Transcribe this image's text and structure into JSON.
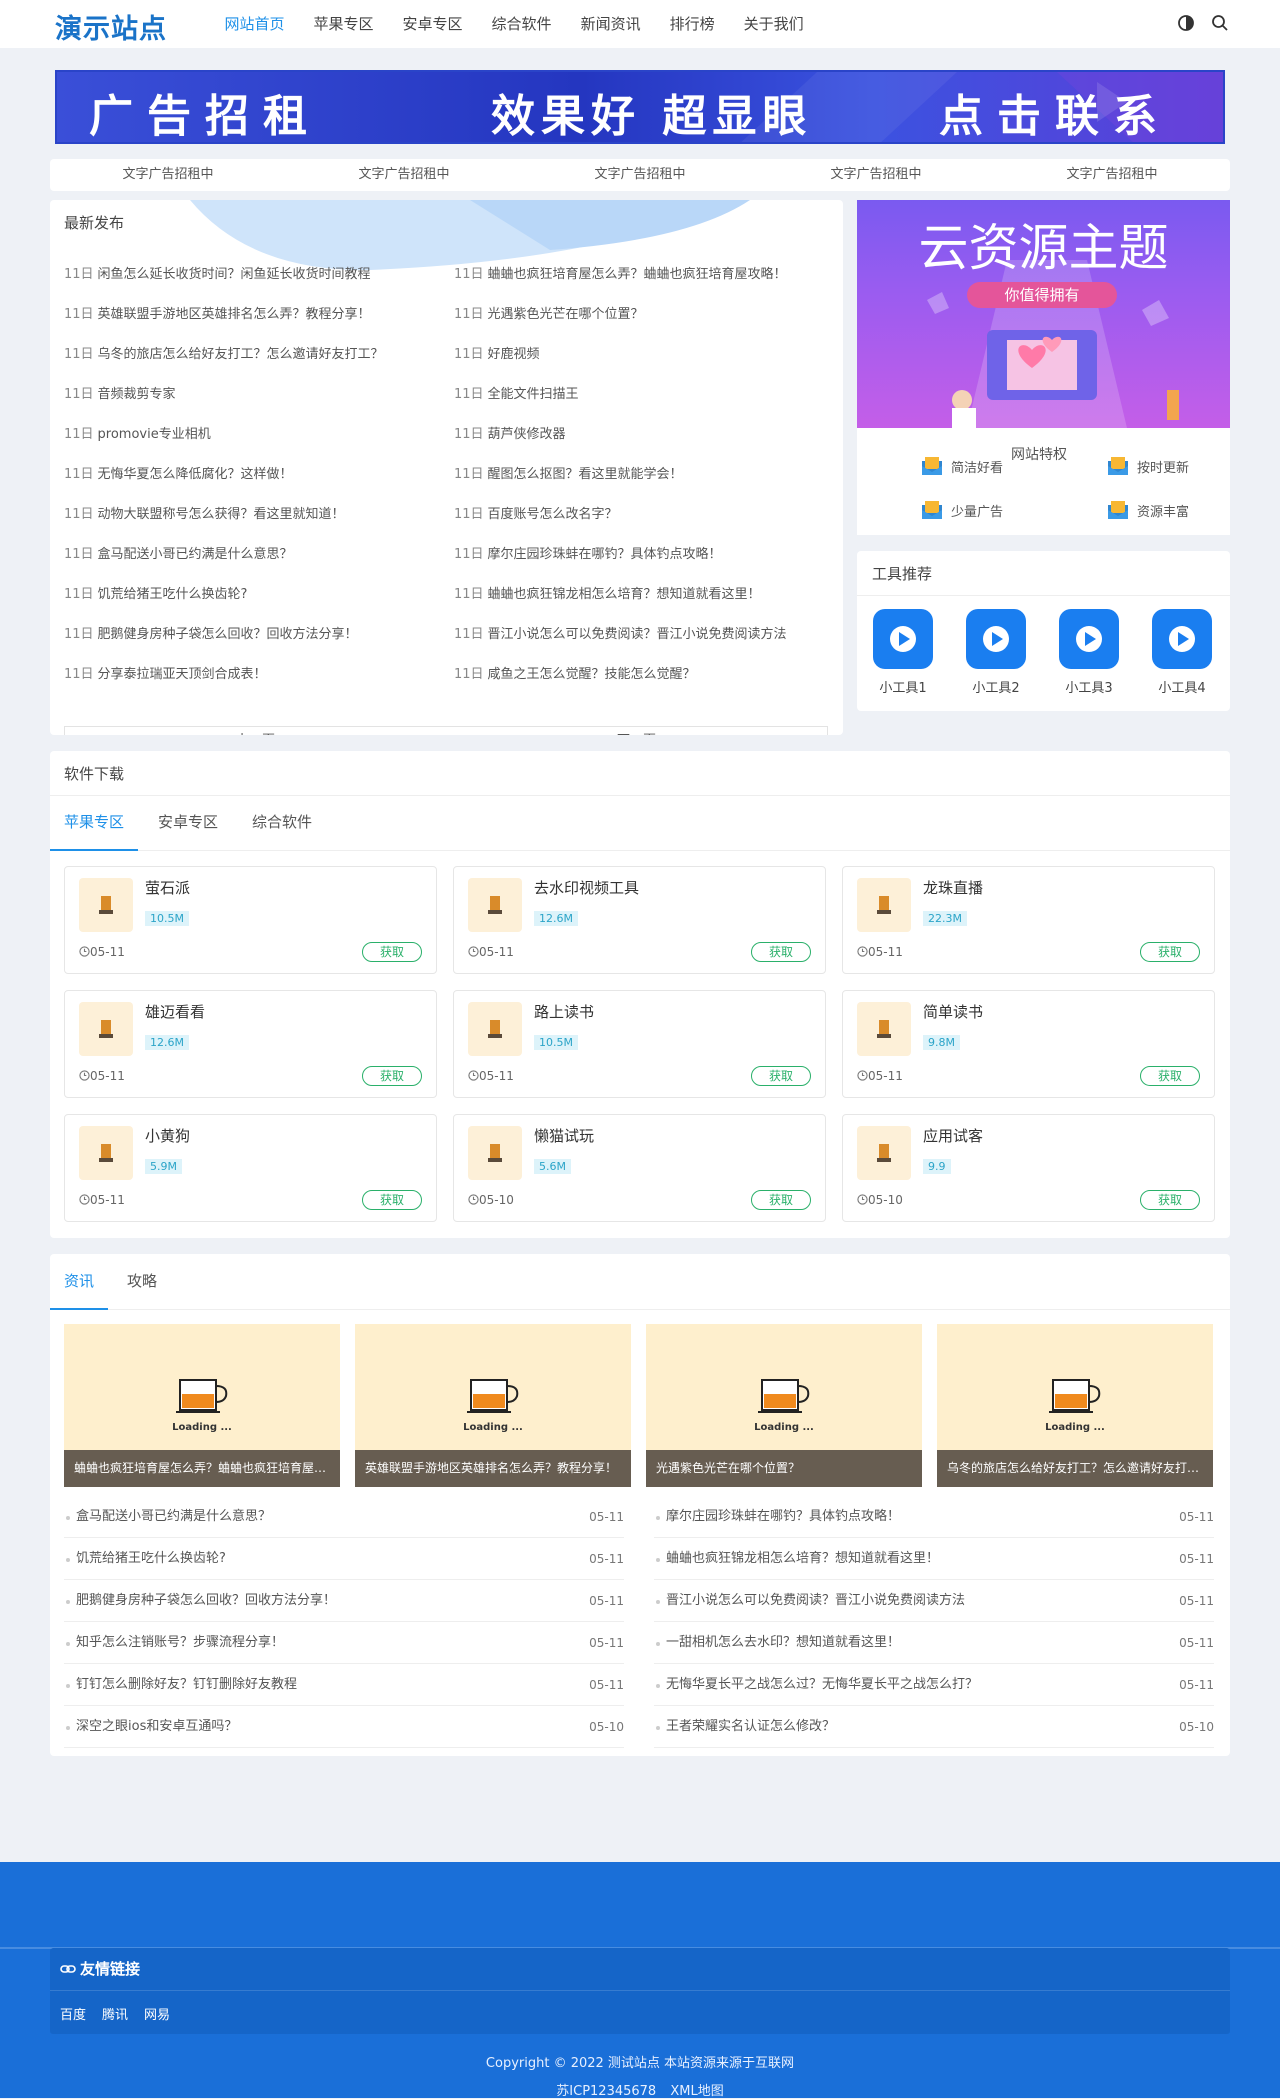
{
  "site": {
    "logo": "演示站点"
  },
  "nav": [
    {
      "label": "网站首页",
      "active": true
    },
    {
      "label": "苹果专区"
    },
    {
      "label": "安卓专区"
    },
    {
      "label": "综合软件"
    },
    {
      "label": "新闻资讯"
    },
    {
      "label": "排行榜"
    },
    {
      "label": "关于我们"
    }
  ],
  "header_icons": [
    "theme-toggle-icon",
    "search-icon"
  ],
  "banner": {
    "left": "广告招租",
    "mid": "效果好 超显眼",
    "right": "点击联系"
  },
  "text_ads": [
    "文字广告招租中",
    "文字广告招租中",
    "文字广告招租中",
    "文字广告招租中",
    "文字广告招租中"
  ],
  "latest": {
    "title": "最新发布",
    "left": [
      {
        "d": "11日",
        "t": "闲鱼怎么延长收货时间？闲鱼延长收货时间教程"
      },
      {
        "d": "11日",
        "t": "英雄联盟手游地区英雄排名怎么弄？教程分享！"
      },
      {
        "d": "11日",
        "t": "乌冬的旅店怎么给好友打工？怎么邀请好友打工？"
      },
      {
        "d": "11日",
        "t": "音频裁剪专家"
      },
      {
        "d": "11日",
        "t": "promovie专业相机"
      },
      {
        "d": "11日",
        "t": "无悔华夏怎么降低腐化？这样做！"
      },
      {
        "d": "11日",
        "t": "动物大联盟称号怎么获得？看这里就知道！"
      },
      {
        "d": "11日",
        "t": "盒马配送小哥已约满是什么意思？"
      },
      {
        "d": "11日",
        "t": "饥荒给猪王吃什么换齿轮?"
      },
      {
        "d": "11日",
        "t": "肥鹅健身房种子袋怎么回收？回收方法分享！"
      },
      {
        "d": "11日",
        "t": "分享泰拉瑞亚天顶剑合成表！"
      }
    ],
    "right": [
      {
        "d": "11日",
        "t": "蛐蛐也疯狂培育屋怎么弄？蛐蛐也疯狂培育屋攻略！"
      },
      {
        "d": "11日",
        "t": "光遇紫色光芒在哪个位置？"
      },
      {
        "d": "11日",
        "t": "好鹿视频"
      },
      {
        "d": "11日",
        "t": "全能文件扫描王"
      },
      {
        "d": "11日",
        "t": "葫芦侠修改器"
      },
      {
        "d": "11日",
        "t": "醒图怎么抠图？看这里就能学会！"
      },
      {
        "d": "11日",
        "t": "百度账号怎么改名字？"
      },
      {
        "d": "11日",
        "t": "摩尔庄园珍珠蚌在哪钓？具体钓点攻略！"
      },
      {
        "d": "11日",
        "t": "蛐蛐也疯狂锦龙相怎么培育？想知道就看这里！"
      },
      {
        "d": "11日",
        "t": "晋江小说怎么可以免费阅读？晋江小说免费阅读方法"
      },
      {
        "d": "11日",
        "t": "咸鱼之王怎么觉醒？技能怎么觉醒？"
      }
    ],
    "prev": "上一页",
    "next": "下一页"
  },
  "promo": {
    "title": "云资源主题",
    "sub": "你值得拥有"
  },
  "features": {
    "title": "网站特权",
    "items": [
      "简洁好看",
      "按时更新",
      "少量广告",
      "资源丰富"
    ]
  },
  "tools": {
    "title": "工具推荐",
    "items": [
      "小工具1",
      "小工具2",
      "小工具3",
      "小工具4"
    ]
  },
  "software": {
    "title": "软件下载",
    "tabs": [
      "苹果专区",
      "安卓专区",
      "综合软件"
    ],
    "get_label": "获取",
    "cards": [
      {
        "name": "萤石派",
        "size": "10.5M",
        "date": "05-11"
      },
      {
        "name": "去水印视频工具",
        "size": "12.6M",
        "date": "05-11"
      },
      {
        "name": "龙珠直播",
        "size": "22.3M",
        "date": "05-11"
      },
      {
        "name": "雄迈看看",
        "size": "12.6M",
        "date": "05-11"
      },
      {
        "name": "路上读书",
        "size": "10.5M",
        "date": "05-11"
      },
      {
        "name": "简单读书",
        "size": "9.8M",
        "date": "05-11"
      },
      {
        "name": "小黄狗",
        "size": "5.9M",
        "date": "05-11"
      },
      {
        "name": "懒猫试玩",
        "size": "5.6M",
        "date": "05-10"
      },
      {
        "name": "应用试客",
        "size": "9.9",
        "date": "05-10"
      }
    ]
  },
  "info": {
    "tabs": [
      "资讯",
      "攻略"
    ],
    "loading": "Loading ...",
    "thumbs": [
      "蛐蛐也疯狂培育屋怎么弄？蛐蛐也疯狂培育屋攻略！",
      "英雄联盟手游地区英雄排名怎么弄？教程分享！",
      "光遇紫色光芒在哪个位置？",
      "乌冬的旅店怎么给好友打工？怎么邀请好友打工？"
    ],
    "left": [
      {
        "t": "盒马配送小哥已约满是什么意思？",
        "d": "05-11"
      },
      {
        "t": "饥荒给猪王吃什么换齿轮?",
        "d": "05-11"
      },
      {
        "t": "肥鹅健身房种子袋怎么回收？回收方法分享！",
        "d": "05-11"
      },
      {
        "t": "知乎怎么注销账号？步骤流程分享！",
        "d": "05-11"
      },
      {
        "t": "钉钉怎么删除好友？钉钉删除好友教程",
        "d": "05-11"
      },
      {
        "t": "深空之眼ios和安卓互通吗？",
        "d": "05-10"
      }
    ],
    "right": [
      {
        "t": "摩尔庄园珍珠蚌在哪钓？具体钓点攻略！",
        "d": "05-11"
      },
      {
        "t": "蛐蛐也疯狂锦龙相怎么培育？想知道就看这里！",
        "d": "05-11"
      },
      {
        "t": "晋江小说怎么可以免费阅读？晋江小说免费阅读方法",
        "d": "05-11"
      },
      {
        "t": "一甜相机怎么去水印？想知道就看这里！",
        "d": "05-11"
      },
      {
        "t": "无悔华夏长平之战怎么过？无悔华夏长平之战怎么打？",
        "d": "05-11"
      },
      {
        "t": "王者荣耀实名认证怎么修改？",
        "d": "05-10"
      }
    ]
  },
  "footer": {
    "links_title": "友情链接",
    "links": [
      "百度",
      "腾讯",
      "网易"
    ],
    "copyright": "Copyright © 2022 测试站点 本站资源来源于互联网",
    "icp": "苏ICP12345678",
    "sitemap": "XML地图"
  },
  "colors": {
    "accent": "#1e90e8",
    "footer": "#1a6fd8",
    "get": "#2ab06a"
  }
}
